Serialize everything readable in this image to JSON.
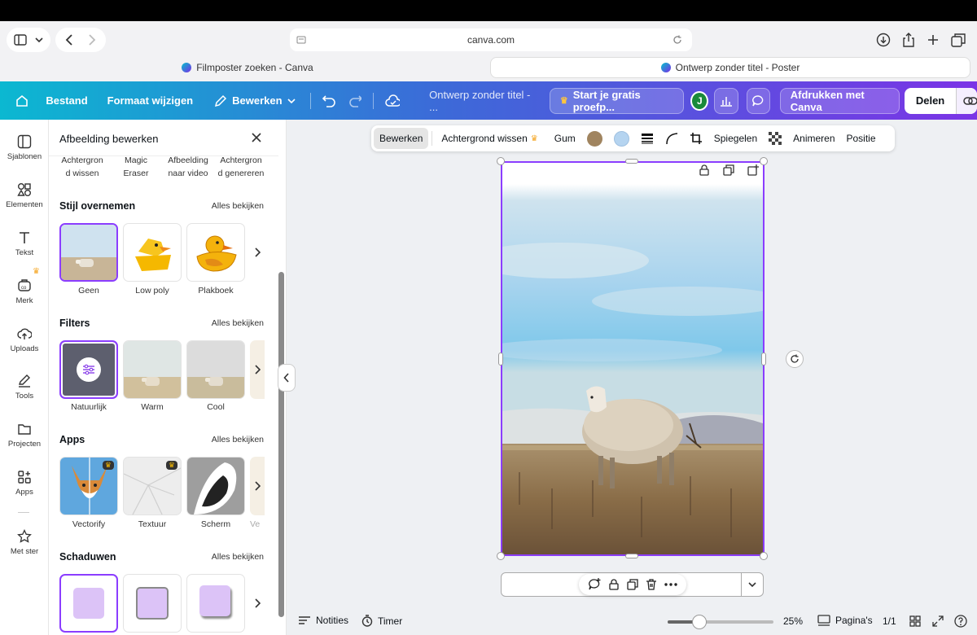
{
  "browser": {
    "url": "canva.com",
    "tabs": [
      {
        "label": "Filmposter zoeken - Canva"
      },
      {
        "label": "Ontwerp zonder titel - Poster"
      }
    ]
  },
  "header": {
    "file": "Bestand",
    "resize": "Formaat wijzigen",
    "edit": "Bewerken",
    "doc_title": "Ontwerp zonder titel - ...",
    "trial": "Start je gratis proefp...",
    "avatar": "J",
    "print": "Afdrukken met Canva",
    "share": "Delen"
  },
  "leftnav": [
    {
      "label": "Sjablonen",
      "icon": "layout-icon"
    },
    {
      "label": "Elementen",
      "icon": "shapes-icon"
    },
    {
      "label": "Tekst",
      "icon": "text-icon"
    },
    {
      "label": "Merk",
      "icon": "brand-icon"
    },
    {
      "label": "Uploads",
      "icon": "upload-icon"
    },
    {
      "label": "Tools",
      "icon": "pen-icon"
    },
    {
      "label": "Projecten",
      "icon": "folder-icon"
    },
    {
      "label": "Apps",
      "icon": "apps-icon"
    },
    {
      "label": "Met ster",
      "icon": "star-icon"
    }
  ],
  "panel": {
    "title": "Afbeelding bewerken",
    "top_tools": [
      {
        "line1": "Achtergron",
        "line2": "d wissen"
      },
      {
        "line1": "Magic",
        "line2": "Eraser"
      },
      {
        "line1": "Afbeelding",
        "line2": "naar video"
      },
      {
        "line1": "Achtergron",
        "line2": "d genereren"
      }
    ],
    "see_all": "Alles bekijken",
    "sections": {
      "style": {
        "title": "Stijl overnemen",
        "items": [
          "Geen",
          "Low poly",
          "Plakboek"
        ]
      },
      "filters": {
        "title": "Filters",
        "items": [
          "Natuurlijk",
          "Warm",
          "Cool"
        ]
      },
      "apps": {
        "title": "Apps",
        "items": [
          "Vectorify",
          "Textuur",
          "Scherm",
          "Ve"
        ]
      },
      "shadows": {
        "title": "Schaduwen"
      }
    }
  },
  "toolbar": {
    "edit": "Bewerken",
    "bg_remove": "Achtergrond wissen",
    "eraser": "Gum",
    "flip": "Spiegelen",
    "animate": "Animeren",
    "position": "Positie",
    "colors": [
      "#a0845f",
      "#b5d4f0"
    ]
  },
  "bottom": {
    "notes": "Notities",
    "timer": "Timer",
    "zoom": "25%",
    "pages": "Pagina's",
    "page_count": "1/1"
  }
}
